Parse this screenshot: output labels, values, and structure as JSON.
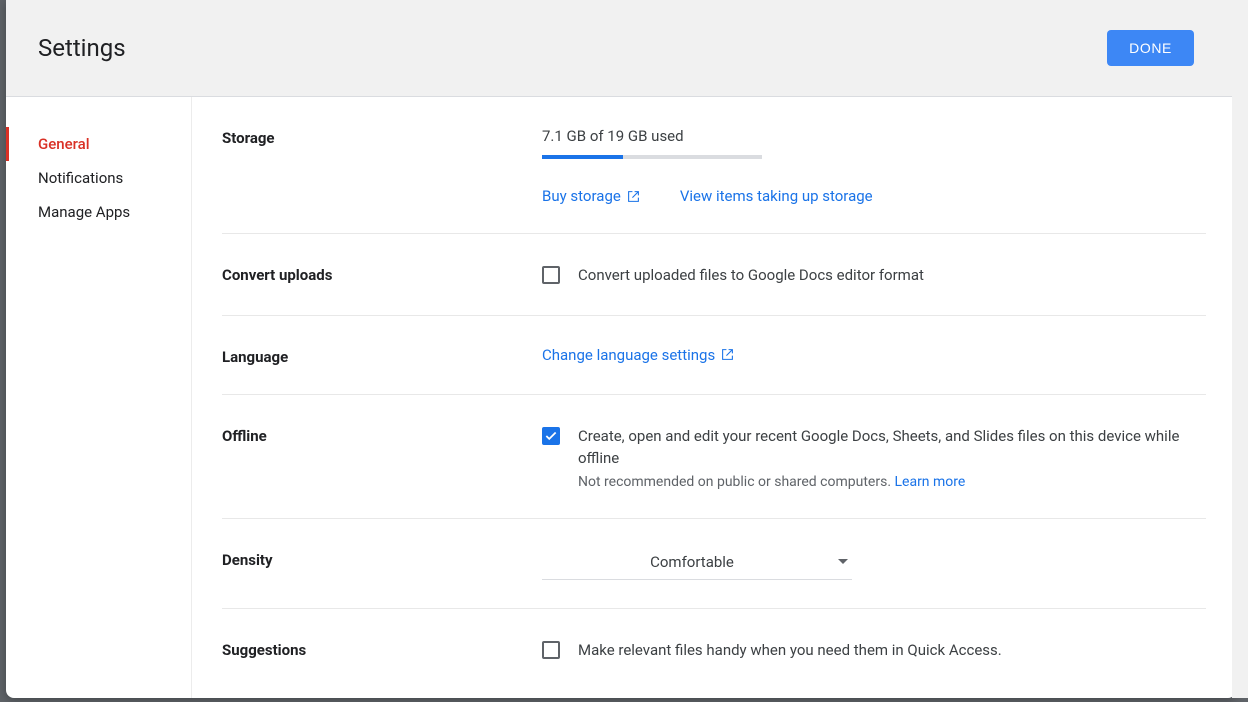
{
  "header": {
    "title": "Settings",
    "done": "DONE"
  },
  "sidebar": {
    "items": [
      {
        "label": "General",
        "active": true
      },
      {
        "label": "Notifications",
        "active": false
      },
      {
        "label": "Manage Apps",
        "active": false
      }
    ]
  },
  "storage": {
    "label": "Storage",
    "usage_text": "7.1 GB of 19 GB used",
    "percent": 37,
    "buy_link": "Buy storage",
    "view_link": "View items taking up storage"
  },
  "convert": {
    "label": "Convert uploads",
    "checked": false,
    "text": "Convert uploaded files to Google Docs editor format"
  },
  "language": {
    "label": "Language",
    "link": "Change language settings"
  },
  "offline": {
    "label": "Offline",
    "checked": true,
    "text": "Create, open and edit your recent Google Docs, Sheets, and Slides files on this device while offline",
    "note": "Not recommended on public or shared computers. ",
    "learn": "Learn more"
  },
  "density": {
    "label": "Density",
    "value": "Comfortable"
  },
  "suggestions": {
    "label": "Suggestions",
    "checked": false,
    "text": "Make relevant files handy when you need them in Quick Access."
  }
}
